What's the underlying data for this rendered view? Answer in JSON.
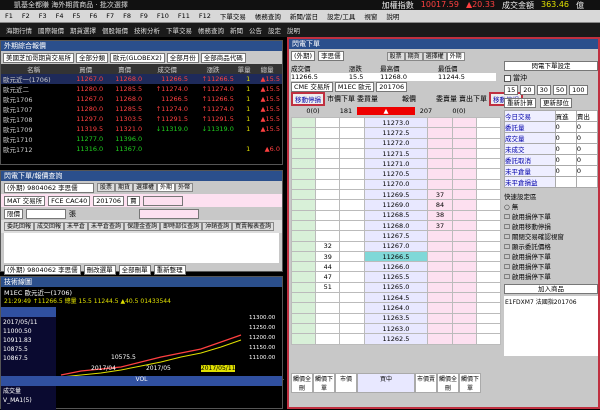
{
  "app": {
    "title": "凱基全都賺  海外期貨商品 · 批次選擇",
    "ticker": [
      {
        "label": "加權指數",
        "value": "10017.59",
        "chg": "▲20.33"
      },
      {
        "label": "成交金額",
        "value": "363.46",
        "unit": "億"
      }
    ]
  },
  "menu": [
    "F1",
    "F2",
    "F3",
    "F4",
    "F5",
    "F6",
    "F7",
    "F8",
    "F9",
    "F10",
    "F11",
    "F12",
    "下單交易",
    "帳務查詢",
    "新聞/當日",
    "設定/工具",
    "視窗",
    "說明"
  ],
  "toolbar": [
    "海期行情",
    "國際報價",
    "期貨選擇",
    "個股報價",
    "技術分析",
    "下單交易",
    "帳務查詢",
    "新聞",
    "公告",
    "設定",
    "說明"
  ],
  "quote": {
    "title": "外期綜合報價",
    "selects": [
      "美國芝加哥期貨交易所",
      "全部分類",
      "歐元(GLOBEX2)",
      "全部月份",
      "全部商品代碼"
    ],
    "headers": [
      "名稱",
      "買價",
      "賣價",
      "成交價",
      "漲跌",
      "單量",
      "總量"
    ],
    "rows": [
      [
        "歐元近一(1706)",
        "11267.0",
        "11268.0",
        "11266.5",
        "↑11266.5",
        "1",
        "▲15.5"
      ],
      [
        "歐元近二",
        "11280.0",
        "11285.5",
        "↑11274.0",
        "↑11274.0",
        "1",
        "▲15.5"
      ],
      [
        "歐元1706",
        "11267.0",
        "11268.0",
        "11266.5",
        "↑11266.5",
        "1",
        "▲15.5"
      ],
      [
        "歐元1707",
        "11280.0",
        "11285.5",
        "↑11274.0",
        "↑11274.0",
        "1",
        "▲15.5"
      ],
      [
        "歐元1708",
        "11297.0",
        "11303.5",
        "↑11291.5",
        "↑11291.5",
        "1",
        "▲15.5"
      ],
      [
        "歐元1709",
        "11319.5",
        "11321.0",
        "↓11319.0",
        "↓11319.0",
        "1",
        "▲15.5"
      ],
      [
        "歐元1710",
        "11277.0",
        "11396.0",
        "",
        "",
        "",
        ""
      ],
      [
        "歐元1712",
        "11316.0",
        "11367.0",
        "",
        "",
        "1",
        "▲6.0"
      ]
    ]
  },
  "order": {
    "title": "閃電下單/報價查詢",
    "account": "(外期)  9804062 李思儒",
    "tabs": [
      "股票",
      "期貨",
      "選擇權",
      "外期",
      "外幣"
    ],
    "exchange": "MAT 交易所",
    "product": "FCE  CAC40",
    "month": "201706",
    "side": "賈",
    "price_type": "限價",
    "qty_label": "張",
    "subtabs": [
      "委託回報",
      "成交回報",
      "未平倉",
      "未平倉查詢",
      "保證金查詢",
      "即時部位查詢",
      "沖銷查詢",
      "買賣報表查詢",
      "客戶資料"
    ],
    "bottom": [
      "(外期) 9804062 李思儒",
      "刪改選單",
      "全部刪單",
      "重新整理"
    ]
  },
  "chart": {
    "title": "技術線圖",
    "symbol": "M1EC 歐元近一(1706)",
    "info": "21:29:49  ↑11266.5  總量 15.5  11244.5  ▲40.5  01433544",
    "prices": [
      "11300.00",
      "11250.00",
      "11200.00",
      "11150.00",
      "11100.00"
    ],
    "left_labels": [
      "2017/05/11",
      "11000.50",
      "10911.83",
      "10875.5",
      "10867.5"
    ],
    "low_label": "10575.5",
    "dates": [
      "2017/04",
      "2017/05",
      "2017/05/11"
    ],
    "vol_label": "VOL",
    "vol_title": "成交量",
    "vol_ma": "V_MA1(5)"
  },
  "trade": {
    "title": "閃電下單",
    "account": "(外期)",
    "name": "李思儒",
    "tabs": [
      "股票",
      "期貨",
      "選擇權",
      "外期"
    ],
    "fields": [
      [
        "成交價",
        "11266.5"
      ],
      [
        "漲跌",
        "15.5"
      ],
      [
        "最高價",
        "11268.0"
      ],
      [
        "最低價",
        "11244.5"
      ]
    ],
    "exchange": "CME 交易所",
    "product": "M1EC 歐元",
    "month": "201706",
    "qty": "1",
    "btn_setting": "閃電下單設定",
    "btn_move_buy": "移動停損",
    "btn_move_sell": "移動停損",
    "left_cols": [
      "移動停損",
      "市價下單",
      "委買量",
      "報價",
      "委賣量",
      "賣出下單",
      "移動停損"
    ],
    "buy_total": "0(0)",
    "sell_total": "0(0)",
    "buy_q": "181",
    "sell_q": "207",
    "ladder": [
      [
        "",
        "",
        "",
        "11273.0",
        "",
        "",
        ""
      ],
      [
        "",
        "",
        "",
        "11272.5",
        "",
        "",
        ""
      ],
      [
        "",
        "",
        "",
        "11272.0",
        "",
        "",
        ""
      ],
      [
        "",
        "",
        "",
        "11271.5",
        "",
        "",
        ""
      ],
      [
        "",
        "",
        "",
        "11271.0",
        "",
        "",
        ""
      ],
      [
        "",
        "",
        "",
        "11270.5",
        "",
        "",
        ""
      ],
      [
        "",
        "",
        "",
        "11270.0",
        "",
        "",
        ""
      ],
      [
        "",
        "",
        "",
        "11269.5",
        "37",
        "",
        ""
      ],
      [
        "",
        "",
        "",
        "11269.0",
        "84",
        "",
        ""
      ],
      [
        "",
        "",
        "",
        "11268.5",
        "38",
        "",
        ""
      ],
      [
        "",
        "",
        "",
        "11268.0",
        "37",
        "",
        ""
      ],
      [
        "",
        "",
        "",
        "11267.5",
        "",
        "",
        ""
      ],
      [
        "",
        "32",
        "",
        "11267.0",
        "",
        "",
        ""
      ],
      [
        "",
        "39",
        "",
        "11266.5",
        "",
        "",
        ""
      ],
      [
        "",
        "44",
        "",
        "11266.0",
        "",
        "",
        ""
      ],
      [
        "",
        "47",
        "",
        "11265.5",
        "",
        "",
        ""
      ],
      [
        "",
        "51",
        "",
        "11265.0",
        "",
        "",
        ""
      ],
      [
        "",
        "",
        "",
        "11264.5",
        "",
        "",
        ""
      ],
      [
        "",
        "",
        "",
        "11264.0",
        "",
        "",
        ""
      ],
      [
        "",
        "",
        "",
        "11263.5",
        "",
        "",
        ""
      ],
      [
        "",
        "",
        "",
        "11263.0",
        "",
        "",
        ""
      ],
      [
        "",
        "",
        "",
        "11262.5",
        "",
        "",
        ""
      ]
    ],
    "qty_buttons": [
      "15",
      "20",
      "30",
      "50",
      "100"
    ],
    "check": "當沖",
    "side_table": [
      [
        "今日交易",
        "買進",
        "賣出"
      ],
      [
        "委託量",
        "0",
        "0"
      ],
      [
        "成交量",
        "0",
        "0"
      ],
      [
        "未成交",
        "0",
        "0"
      ],
      [
        "委託取消",
        "0",
        "0"
      ],
      [
        "未平倉量",
        "0",
        "0"
      ],
      [
        "未平倉損益",
        "",
        ""
      ]
    ],
    "quick_title": "快速設定區",
    "options": [
      "無",
      "啟用損停下單",
      "啟用移動停損",
      "關閉交易確認視窗",
      "顯示委託價格",
      "啟用損停下單",
      "啟用損停下單",
      "啟用損停下單"
    ],
    "reset": "重新計算",
    "update": "更新部位",
    "add_item": "加入商品",
    "product_label": "E1FDXM7 法國指201706",
    "footer": [
      "觸價全刪",
      "觸價下單",
      "市價",
      "買中",
      "市價賣",
      "觸價全刪",
      "觸價下單"
    ],
    "footer2": [
      "觸價買出",
      "觸價賣",
      "",
      "賣中",
      "",
      "",
      "觸價賣出"
    ],
    "center_label": "買中"
  }
}
